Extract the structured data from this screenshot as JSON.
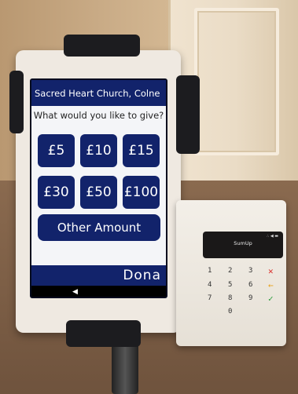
{
  "kiosk": {
    "header_title": "Sacred Heart Church, Colne",
    "prompt": "What would you like to give?",
    "amounts": [
      "£5",
      "£10",
      "£15",
      "£30",
      "£50",
      "£100"
    ],
    "other_amount_label": "Other Amount",
    "brand": "Dona",
    "nav_back": "◀"
  },
  "card_reader": {
    "display_text": "SumUp",
    "status_icons": "∴ ◀ ▬",
    "keys": [
      "1",
      "2",
      "3",
      "4",
      "5",
      "6",
      "7",
      "8",
      "9",
      "0"
    ],
    "cancel_key": "✕",
    "clear_key": "←",
    "confirm_key": "✓"
  },
  "colors": {
    "primary": "#12236b",
    "screen_bg": "#f4f5f8",
    "cancel": "#d9302c",
    "clear": "#e8a21a",
    "confirm": "#2f9e3f"
  }
}
